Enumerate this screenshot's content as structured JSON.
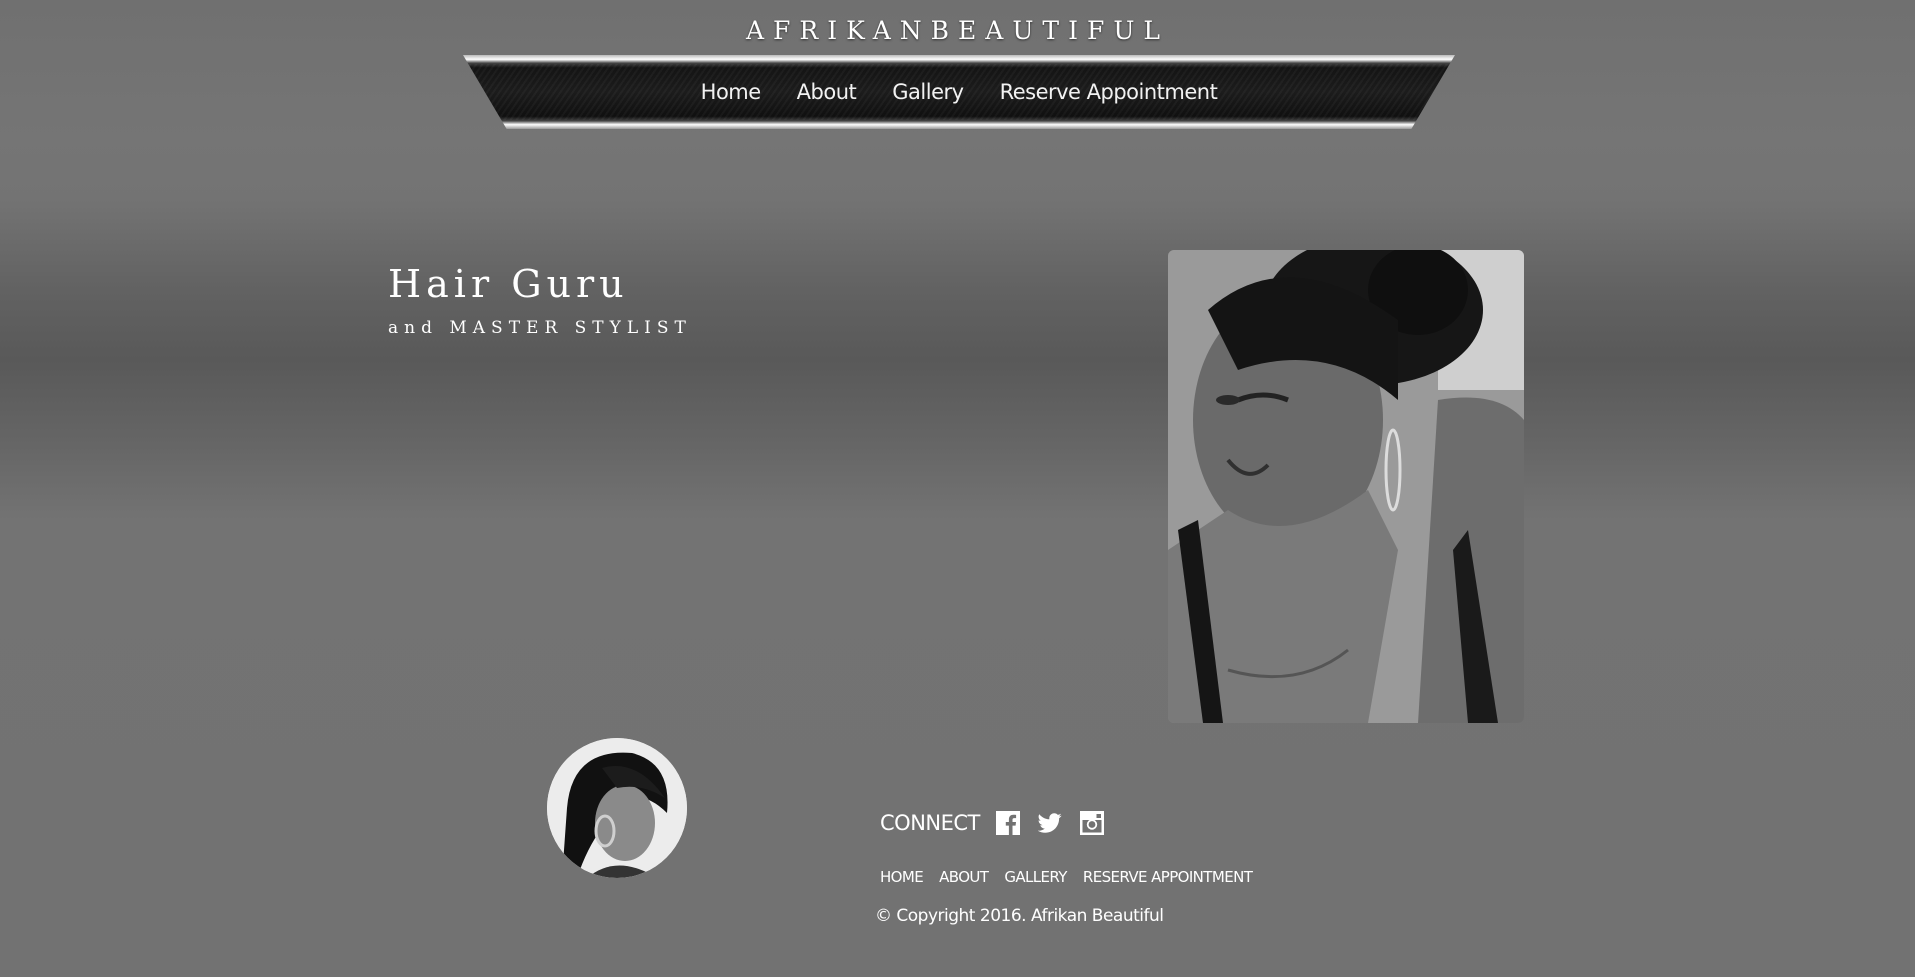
{
  "brand": {
    "title": "AFRIKANBEAUTIFUL"
  },
  "nav": {
    "items": [
      {
        "label": "Home"
      },
      {
        "label": "About"
      },
      {
        "label": "Gallery"
      },
      {
        "label": "Reserve Appointment"
      }
    ]
  },
  "hero": {
    "title": "Hair Guru",
    "subtitle": "and MASTER STYLIST"
  },
  "footer": {
    "connect_label": "CONNECT",
    "social": [
      {
        "icon": "facebook-icon"
      },
      {
        "icon": "twitter-icon"
      },
      {
        "icon": "instagram-icon"
      }
    ],
    "links": [
      {
        "label": "HOME"
      },
      {
        "label": "ABOUT"
      },
      {
        "label": "GALLERY"
      },
      {
        "label": "RESERVE APPOINTMENT"
      }
    ],
    "copyright": "© Copyright 2016. Afrikan Beautiful"
  }
}
